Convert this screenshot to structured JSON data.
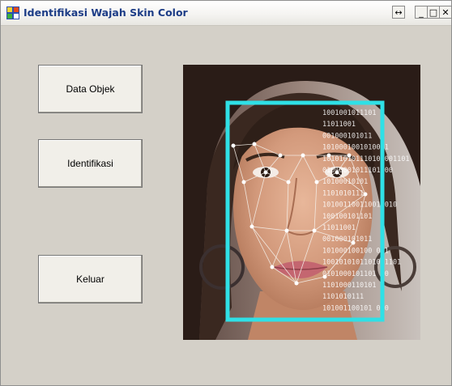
{
  "window": {
    "title": "Identifikasi Wajah Skin Color"
  },
  "titlebar_buttons": {
    "restore_glyph": "↔",
    "minimize_glyph": "_",
    "maximize_glyph": "□",
    "close_glyph": "✕"
  },
  "buttons": {
    "data_objek": "Data Objek",
    "identifikasi": "Identifikasi",
    "keluar": "Keluar"
  },
  "picture": {
    "binary_lines": [
      "1001001011101",
      "11011001",
      "001000101011",
      "1010001001010001",
      "101010101110100001101",
      "01010001011101 00",
      "10100010101",
      "1101010111",
      "10100110011001 010",
      "100100101101",
      "11011001",
      "001000101011",
      "101000100100 011",
      "1001010101101001101",
      "0101000101101 00",
      "1101000110101",
      "1101010111",
      "101001100101 010"
    ]
  },
  "colors": {
    "detection_box": "#2fe0e6",
    "window_bg": "#d4d0c8",
    "title_text": "#1c3c86"
  }
}
